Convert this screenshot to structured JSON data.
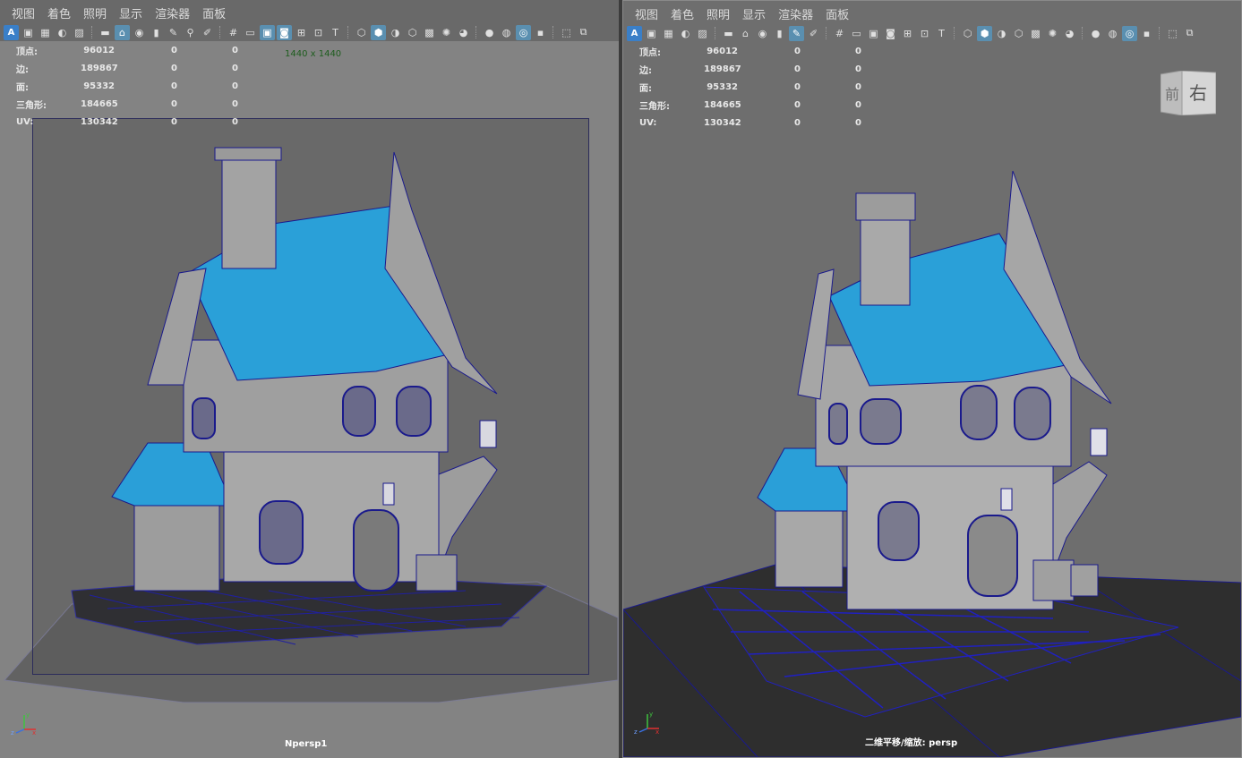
{
  "menu": [
    "视图",
    "着色",
    "照明",
    "显示",
    "渲染器",
    "面板"
  ],
  "hud": {
    "rows": [
      {
        "label": "顶点:",
        "v1": "96012",
        "v2": "0",
        "v3": "0"
      },
      {
        "label": "边:",
        "v1": "189867",
        "v2": "0",
        "v3": "0"
      },
      {
        "label": "面:",
        "v1": "95332",
        "v2": "0",
        "v3": "0"
      },
      {
        "label": "三角形:",
        "v1": "184665",
        "v2": "0",
        "v3": "0"
      },
      {
        "label": "UV:",
        "v1": "130342",
        "v2": "0",
        "v3": "0"
      }
    ]
  },
  "left_panel": {
    "resolution_label": "1440 x 1440",
    "camera_label": "Npersp1"
  },
  "right_panel": {
    "camera_label": "二维平移/缩放: persp",
    "viewcube": {
      "face_front": "前",
      "face_right": "右"
    }
  },
  "colors": {
    "viewport_bg": "#696969",
    "wire": "#1a1a8c",
    "roof": "#2aa0d8",
    "wall": "#b4b4b4",
    "ground": "#3a3a3a",
    "accent": "#5a8fb0"
  },
  "axis": {
    "x": "x",
    "y": "y",
    "z": "z"
  }
}
